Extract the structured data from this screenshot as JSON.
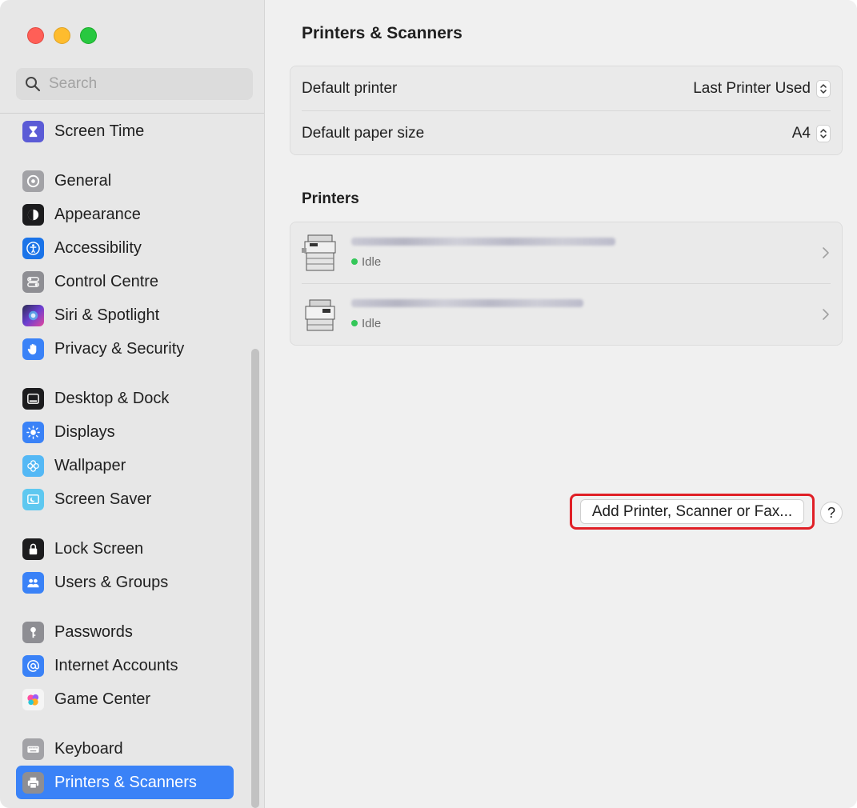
{
  "sidebar": {
    "search_placeholder": "Search",
    "items": [
      {
        "label": "Screen Time",
        "icon": "hourglass-icon",
        "color": "#5b5bd6",
        "active": false
      },
      {
        "label": "General",
        "icon": "gear-icon",
        "color": "#8e8e93",
        "active": false
      },
      {
        "label": "Appearance",
        "icon": "appearance-icon",
        "color": "#1c1c1e",
        "active": false
      },
      {
        "label": "Accessibility",
        "icon": "accessibility-icon",
        "color": "#1a73e8",
        "active": false
      },
      {
        "label": "Control Centre",
        "icon": "toggles-icon",
        "color": "#8e8e93",
        "active": false
      },
      {
        "label": "Siri & Spotlight",
        "icon": "siri-icon",
        "color": "#6b3fd1",
        "active": false
      },
      {
        "label": "Privacy & Security",
        "icon": "hand-icon",
        "color": "#3a82f7",
        "active": false
      },
      {
        "label": "Desktop & Dock",
        "icon": "dock-icon",
        "color": "#1c1c1e",
        "active": false
      },
      {
        "label": "Displays",
        "icon": "sun-icon",
        "color": "#3a82f7",
        "active": false
      },
      {
        "label": "Wallpaper",
        "icon": "flower-icon",
        "color": "#54b8f5",
        "active": false
      },
      {
        "label": "Screen Saver",
        "icon": "screensaver-icon",
        "color": "#5ec8f0",
        "active": false
      },
      {
        "label": "Lock Screen",
        "icon": "lock-icon",
        "color": "#1c1c1e",
        "active": false
      },
      {
        "label": "Users & Groups",
        "icon": "users-icon",
        "color": "#3a82f7",
        "active": false
      },
      {
        "label": "Passwords",
        "icon": "key-icon",
        "color": "#8e8e93",
        "active": false
      },
      {
        "label": "Internet Accounts",
        "icon": "at-icon",
        "color": "#3a82f7",
        "active": false
      },
      {
        "label": "Game Center",
        "icon": "game-center-icon",
        "color": "#f5f5f5",
        "active": false
      },
      {
        "label": "Keyboard",
        "icon": "keyboard-icon",
        "color": "#8e8e93",
        "active": false
      },
      {
        "label": "Printers & Scanners",
        "icon": "printer-icon",
        "color": "#8e8e93",
        "active": true
      }
    ]
  },
  "main": {
    "title": "Printers & Scanners",
    "defaults": {
      "default_printer_label": "Default printer",
      "default_printer_value": "Last Printer Used",
      "paper_size_label": "Default paper size",
      "paper_size_value": "A4"
    },
    "printers_heading": "Printers",
    "printers": [
      {
        "status": "Idle",
        "status_color": "#34c759"
      },
      {
        "status": "Idle",
        "status_color": "#34c759"
      }
    ],
    "add_button_label": "Add Printer, Scanner or Fax...",
    "help_label": "?"
  },
  "colors": {
    "accent": "#3a82f7",
    "highlight_border": "#e01f26"
  }
}
